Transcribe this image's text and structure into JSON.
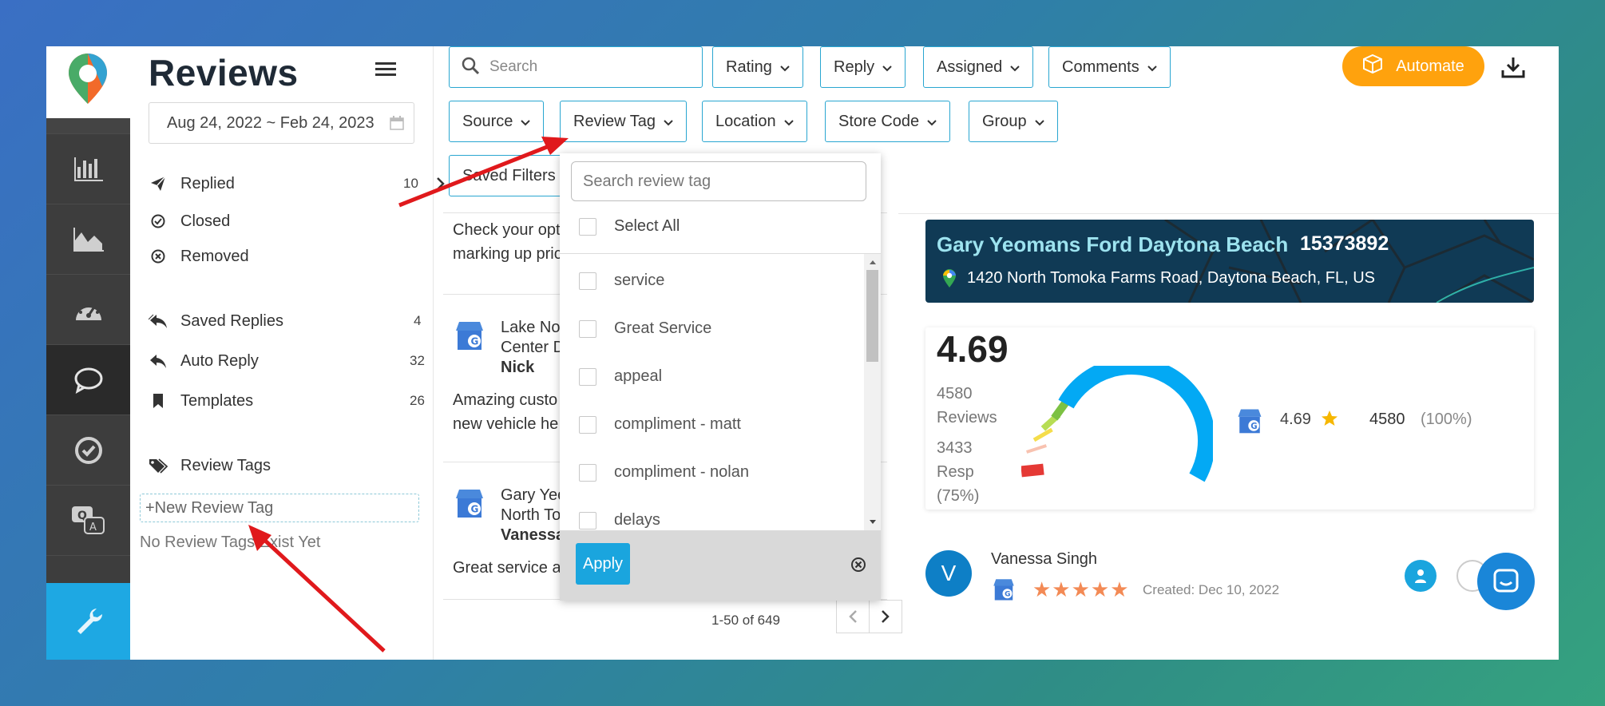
{
  "header": {
    "title": "Reviews"
  },
  "sidebar": {
    "date_range": "Aug 24, 2022 ~ Feb 24, 2023",
    "status_items": [
      {
        "label": "Replied",
        "count": "10"
      },
      {
        "label": "Closed"
      },
      {
        "label": "Removed"
      }
    ],
    "tools": [
      {
        "label": "Saved Replies",
        "count": "4"
      },
      {
        "label": "Auto Reply",
        "count": "32"
      },
      {
        "label": "Templates",
        "count": "26"
      }
    ],
    "review_tags_label": "Review Tags",
    "new_tag_label": "+New Review Tag",
    "no_tags_text": "No Review Tags Exist Yet"
  },
  "filters": {
    "search_placeholder": "Search",
    "row1": [
      "Rating",
      "Reply",
      "Assigned",
      "Comments"
    ],
    "row2": [
      "Source",
      "Review Tag",
      "Location",
      "Store Code",
      "Group"
    ],
    "saved_filters": "Saved Filters",
    "automate_label": "Automate"
  },
  "reviews": [
    {
      "text1": "Check your opt",
      "text2": "marking up pric"
    },
    {
      "name1": "Lake No",
      "name2": "Center D",
      "author": "Nick",
      "text1": "Amazing custo",
      "text2": "new vehicle he"
    },
    {
      "name1": "Gary Yeo",
      "name2": "North To",
      "author": "Vanessa",
      "text1": "Great service a"
    }
  ],
  "pagination": {
    "range": "1-50 of 649"
  },
  "tag_dropdown": {
    "search_placeholder": "Search review tag",
    "select_all": "Select All",
    "options": [
      "service",
      "Great Service",
      "appeal",
      "compliment - matt",
      "compliment - nolan",
      "delays"
    ],
    "apply_label": "Apply"
  },
  "location": {
    "name": "Gary Yeomans Ford Daytona Beach",
    "id": "15373892",
    "address": "1420 North Tomoka Farms Road, Daytona Beach, FL, US"
  },
  "stats": {
    "rating": "4.69",
    "reviews_count": "4580",
    "reviews_label": "Reviews",
    "resp_count": "3433",
    "resp_label": "Resp",
    "resp_pct": "(75%)",
    "google_rating": "4.69",
    "google_count": "4580",
    "google_pct": "(100%)"
  },
  "selected_review": {
    "avatar_letter": "V",
    "reviewer": "Vanessa Singh",
    "stars": 5,
    "stars_text": "★★★★★",
    "created": "Created: Dec 10, 2022"
  },
  "colors": {
    "accent": "#29a6d1",
    "automate": "#ffa20d",
    "rail": "#3d3d3d",
    "tool_active": "#1ea8e3"
  }
}
